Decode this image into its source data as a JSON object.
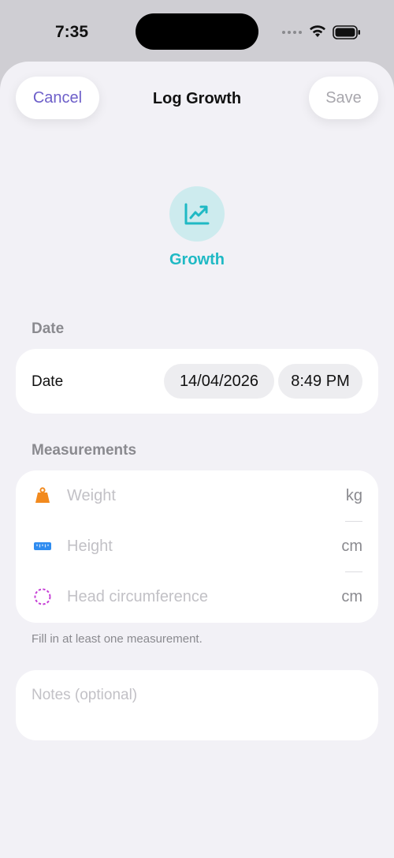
{
  "status_bar": {
    "time": "7:35"
  },
  "header": {
    "cancel_label": "Cancel",
    "title": "Log Growth",
    "save_label": "Save"
  },
  "category": {
    "label": "Growth",
    "icon": "chart-line-up-icon",
    "color": "#1fb9c4"
  },
  "date_section": {
    "header": "Date",
    "row_label": "Date",
    "date_value": "14/04/2026",
    "time_value": "8:49 PM"
  },
  "measurements_section": {
    "header": "Measurements",
    "rows": [
      {
        "placeholder": "Weight",
        "unit": "kg",
        "icon": "weight-icon",
        "color": "#f28a1e"
      },
      {
        "placeholder": "Height",
        "unit": "cm",
        "icon": "ruler-icon",
        "color": "#2f8cf0"
      },
      {
        "placeholder": "Head circumference",
        "unit": "cm",
        "icon": "circle-dashed-icon",
        "color": "#c63fd6"
      }
    ],
    "hint": "Fill in at least one measurement."
  },
  "notes": {
    "placeholder": "Notes (optional)"
  },
  "colors": {
    "accent": "#6d5fc9",
    "background": "#f2f1f6"
  }
}
